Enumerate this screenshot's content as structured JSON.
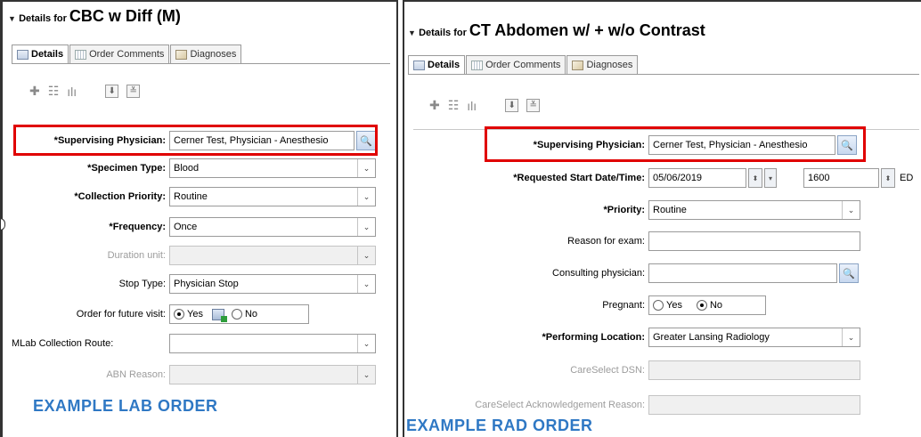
{
  "lab": {
    "header_prefix": "Details for",
    "header_title": "CBC w Diff (M)",
    "tabs": [
      {
        "label": "Details",
        "icon": "details-icon"
      },
      {
        "label": "Order Comments",
        "icon": "comments-icon"
      },
      {
        "label": "Diagnoses",
        "icon": "diagnoses-icon"
      }
    ],
    "toolbar_icons": [
      "add-icon",
      "hierarchy-icon",
      "chart-icon",
      "pin-icon",
      "expand-icon"
    ],
    "fields": [
      {
        "label": "*Supervising Physician:",
        "value": "Cerner Test, Physician - Anesthesio"
      },
      {
        "label": "*Specimen Type:",
        "value": "Blood"
      },
      {
        "label": "*Collection Priority:",
        "value": "Routine"
      },
      {
        "label": "*Frequency:",
        "value": "Once"
      },
      {
        "label": "Duration unit:",
        "value": ""
      },
      {
        "label": "Stop Type:",
        "value": "Physician Stop"
      },
      {
        "label": "Order for future visit:",
        "yes": "Yes",
        "no": "No",
        "selected": "Yes"
      },
      {
        "label": "MLab Collection Route:",
        "value": ""
      },
      {
        "label": "ABN Reason:",
        "value": ""
      }
    ],
    "caption": "EXAMPLE LAB ORDER"
  },
  "rad": {
    "header_prefix": "Details for",
    "header_title": "CT Abdomen w/ + w/o Contrast",
    "tabs": [
      {
        "label": "Details",
        "icon": "details-icon"
      },
      {
        "label": "Order Comments",
        "icon": "comments-icon"
      },
      {
        "label": "Diagnoses",
        "icon": "diagnoses-icon"
      }
    ],
    "toolbar_icons": [
      "add-icon",
      "hierarchy-icon",
      "chart-icon",
      "pin-icon",
      "expand-icon"
    ],
    "fields": [
      {
        "label": "*Supervising Physician:",
        "value": "Cerner Test, Physician - Anesthesio"
      },
      {
        "label": "*Requested Start Date/Time:",
        "date": "05/06/2019",
        "time": "1600",
        "tz": "ED"
      },
      {
        "label": "*Priority:",
        "value": "Routine"
      },
      {
        "label": "Reason for exam:",
        "value": ""
      },
      {
        "label": "Consulting physician:",
        "value": ""
      },
      {
        "label": "Pregnant:",
        "yes": "Yes",
        "no": "No",
        "selected": "No"
      },
      {
        "label": "*Performing Location:",
        "value": "Greater Lansing Radiology"
      },
      {
        "label": "CareSelect DSN:",
        "value": ""
      },
      {
        "label": "CareSelect Acknowledgement Reason:",
        "value": ""
      }
    ],
    "caption": "EXAMPLE RAD ORDER"
  },
  "colors": {
    "highlight": "#e00000",
    "caption": "#2f78c4"
  }
}
